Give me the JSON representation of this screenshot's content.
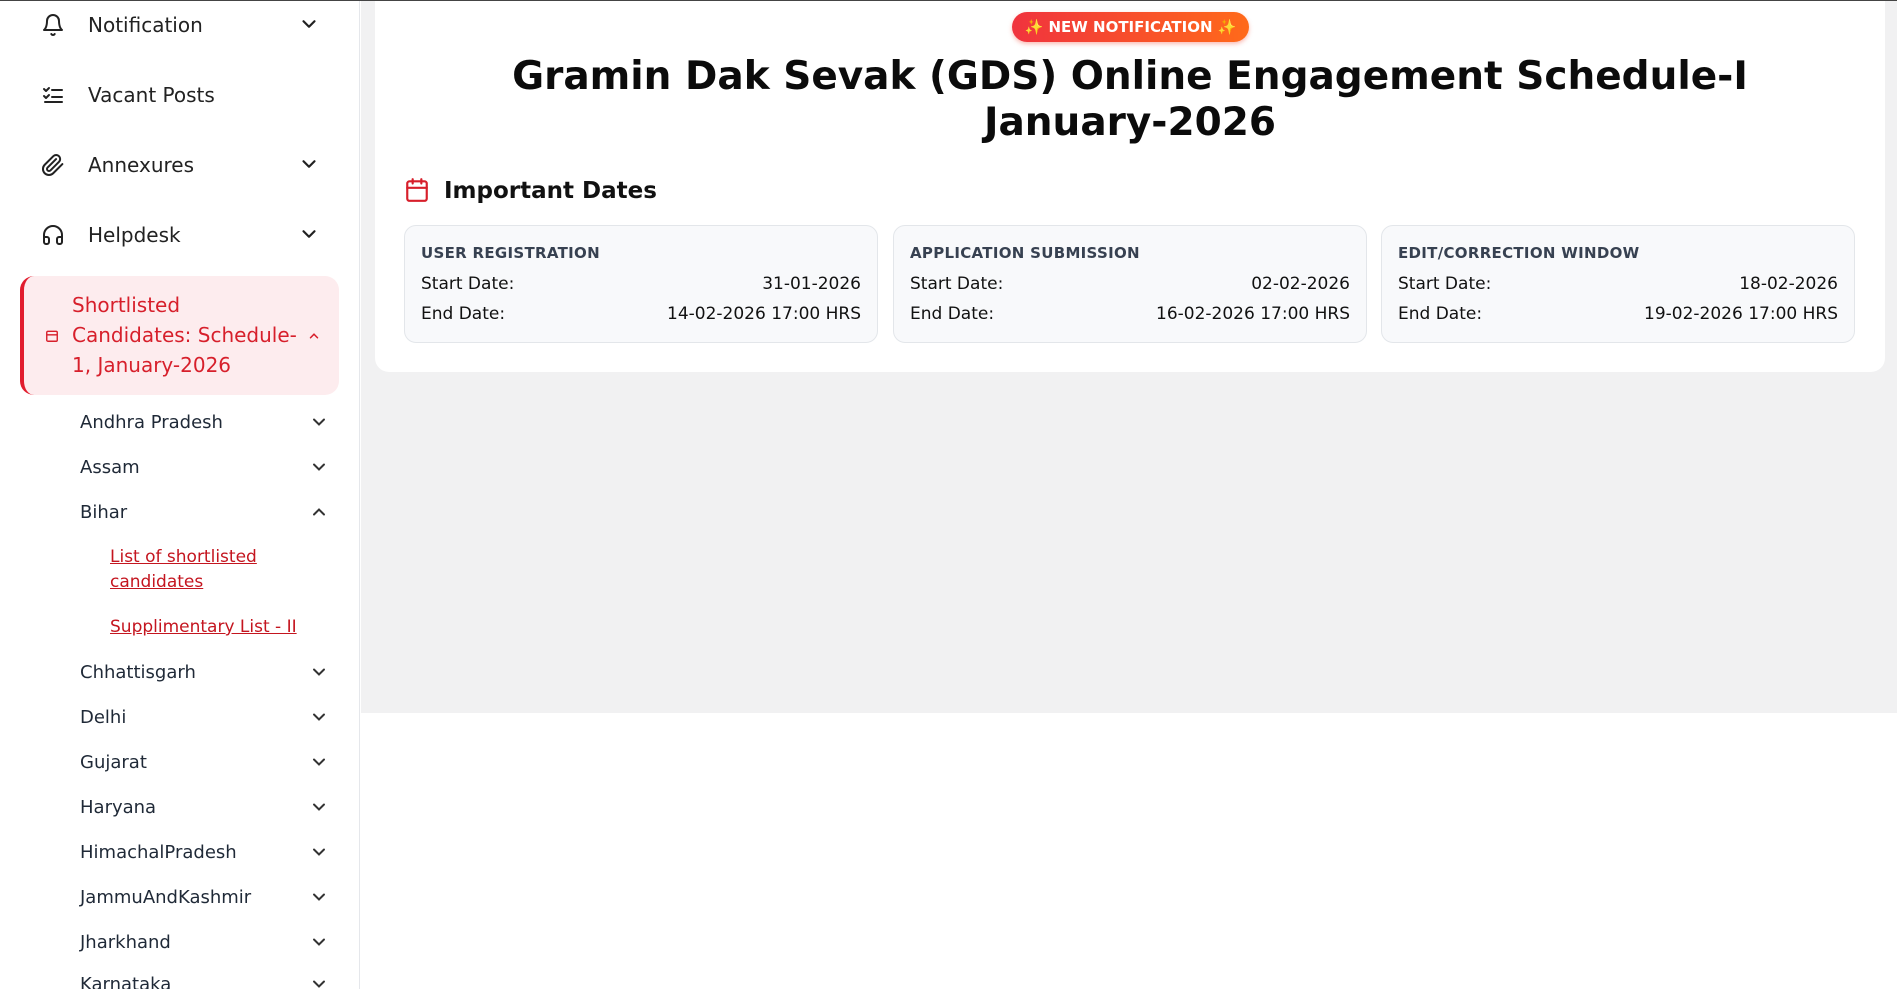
{
  "sidebar": {
    "items": [
      {
        "label": "Notification",
        "icon": "bell-icon"
      },
      {
        "label": "Vacant Posts",
        "icon": "checklist-icon"
      },
      {
        "label": "Annexures",
        "icon": "paperclip-icon"
      },
      {
        "label": "Helpdesk",
        "icon": "headset-icon"
      }
    ],
    "active": {
      "label": "Shortlisted Candidates: Schedule-1, January-2026"
    },
    "states": [
      "Andhra Pradesh",
      "Assam",
      "Bihar",
      "Chhattisgarh",
      "Delhi",
      "Gujarat",
      "Haryana",
      "HimachalPradesh",
      "JammuAndKashmir",
      "Jharkhand",
      "Karnataka"
    ],
    "bihar_links": [
      "List of shortlisted candidates",
      "Supplimentary List - II"
    ]
  },
  "main": {
    "badge": "✨ NEW NOTIFICATION ✨",
    "title": "Gramin Dak Sevak (GDS) Online Engagement Schedule-I January-2026",
    "important_dates_heading": "Important Dates",
    "cards": [
      {
        "heading": "USER REGISTRATION",
        "start_label": "Start Date:",
        "start": "31-01-2026",
        "end_label": "End Date:",
        "end": "14-02-2026 17:00 HRS"
      },
      {
        "heading": "APPLICATION SUBMISSION",
        "start_label": "Start Date:",
        "start": "02-02-2026",
        "end_label": "End Date:",
        "end": "16-02-2026 17:00 HRS"
      },
      {
        "heading": "EDIT/CORRECTION WINDOW",
        "start_label": "Start Date:",
        "start": "18-02-2026",
        "end_label": "End Date:",
        "end": "19-02-2026 17:00 HRS"
      }
    ]
  },
  "colors": {
    "accent": "#d71f2b",
    "active_bg": "#fdecee",
    "badge_start": "#f0333e",
    "badge_end": "#ff6a1a"
  }
}
